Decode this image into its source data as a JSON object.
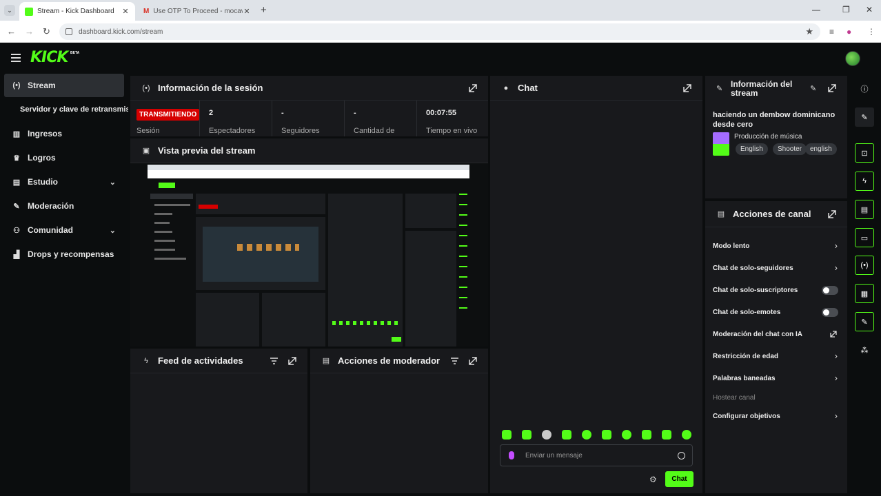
{
  "browser": {
    "tabs": [
      {
        "title": "Stream - Kick Dashboard"
      },
      {
        "title": "Use OTP To Proceed - mocavent"
      }
    ],
    "url": "dashboard.kick.com/stream"
  },
  "header": {
    "logo": "KICK",
    "beta": "BETA"
  },
  "sidebar": {
    "items": [
      {
        "label": "Stream",
        "icon": "broadcast-icon",
        "active": true
      },
      {
        "label": "Servidor y clave de retransmisión"
      },
      {
        "label": "Ingresos",
        "icon": "chart-icon"
      },
      {
        "label": "Logros",
        "icon": "trophy-icon"
      },
      {
        "label": "Estudio",
        "icon": "studio-icon"
      },
      {
        "label": "Moderación",
        "icon": "wrench-icon"
      },
      {
        "label": "Comunidad",
        "icon": "community-icon"
      },
      {
        "label": "Drops y recompensas",
        "icon": "drops-icon"
      }
    ]
  },
  "session": {
    "title": "Información de la sesión",
    "status": "TRANSMITIENDO",
    "status_label": "Sesión",
    "viewers": "2",
    "viewers_label": "Espectadores",
    "followers": "-",
    "followers_label": "Seguidores",
    "amount": "-",
    "amount_label": "Cantidad de",
    "uptime": "00:07:55",
    "uptime_label": "Tiempo en vivo"
  },
  "preview": {
    "title": "Vista previa del stream"
  },
  "feed": {
    "title": "Feed de actividades"
  },
  "modactions": {
    "title": "Acciones de moderador"
  },
  "chat": {
    "title": "Chat",
    "placeholder": "Enviar un mensaje",
    "send_label": "Chat"
  },
  "streaminfo": {
    "title_line1": "Información del",
    "title_line2": "stream",
    "stream_title": "haciendo un dembow dominicano desde cero",
    "category": "Producción de música",
    "tags": [
      "English",
      "Shooter",
      "english"
    ]
  },
  "channel": {
    "title": "Acciones de canal",
    "actions": [
      {
        "label": "Modo lento",
        "control": "chevron"
      },
      {
        "label": "Chat de solo-seguidores",
        "control": "chevron"
      },
      {
        "label": "Chat de solo-suscriptores",
        "control": "toggle"
      },
      {
        "label": "Chat de solo-emotes",
        "control": "toggle"
      },
      {
        "label": "Moderación del chat con IA",
        "control": "external"
      },
      {
        "label": "Restricción de edad",
        "control": "chevron"
      },
      {
        "label": "Palabras baneadas",
        "control": "chevron"
      },
      {
        "label": "Hostear canal",
        "control": "none",
        "disabled": true
      },
      {
        "label": "Configurar objetivos",
        "control": "chevron"
      }
    ]
  },
  "colors": {
    "accent": "#53fc18",
    "live": "#d60000",
    "panel": "#18191c",
    "bg": "#0b0d0e"
  }
}
